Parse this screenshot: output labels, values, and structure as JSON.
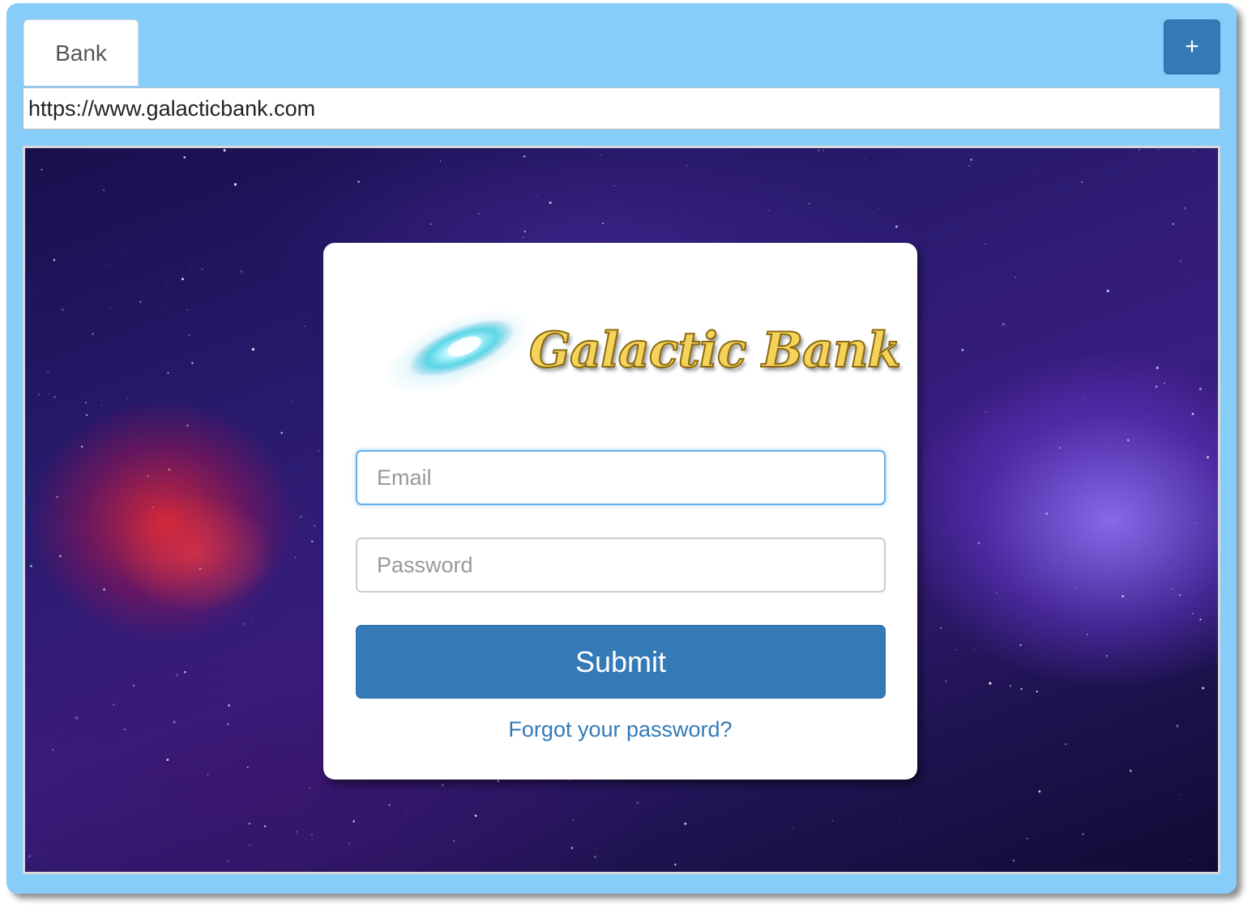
{
  "tabs": [
    {
      "label": "Bank"
    }
  ],
  "toolbar": {
    "new_tab_label": "+"
  },
  "address_bar": {
    "url": "https://www.galacticbank.com"
  },
  "login": {
    "logo_text": "Galactic Bank",
    "email_placeholder": "Email",
    "email_value": "",
    "password_placeholder": "Password",
    "password_value": "",
    "submit_label": "Submit",
    "forgot_label": "Forgot your password?"
  },
  "colors": {
    "window_frame": "#87cdf9",
    "primary_button": "#337ab7",
    "link": "#337ab7",
    "focus_border": "#66afe9",
    "logo_gold": "#f5d25a"
  },
  "icons": {
    "new_tab": "plus-icon",
    "logo": "galaxy-icon"
  }
}
